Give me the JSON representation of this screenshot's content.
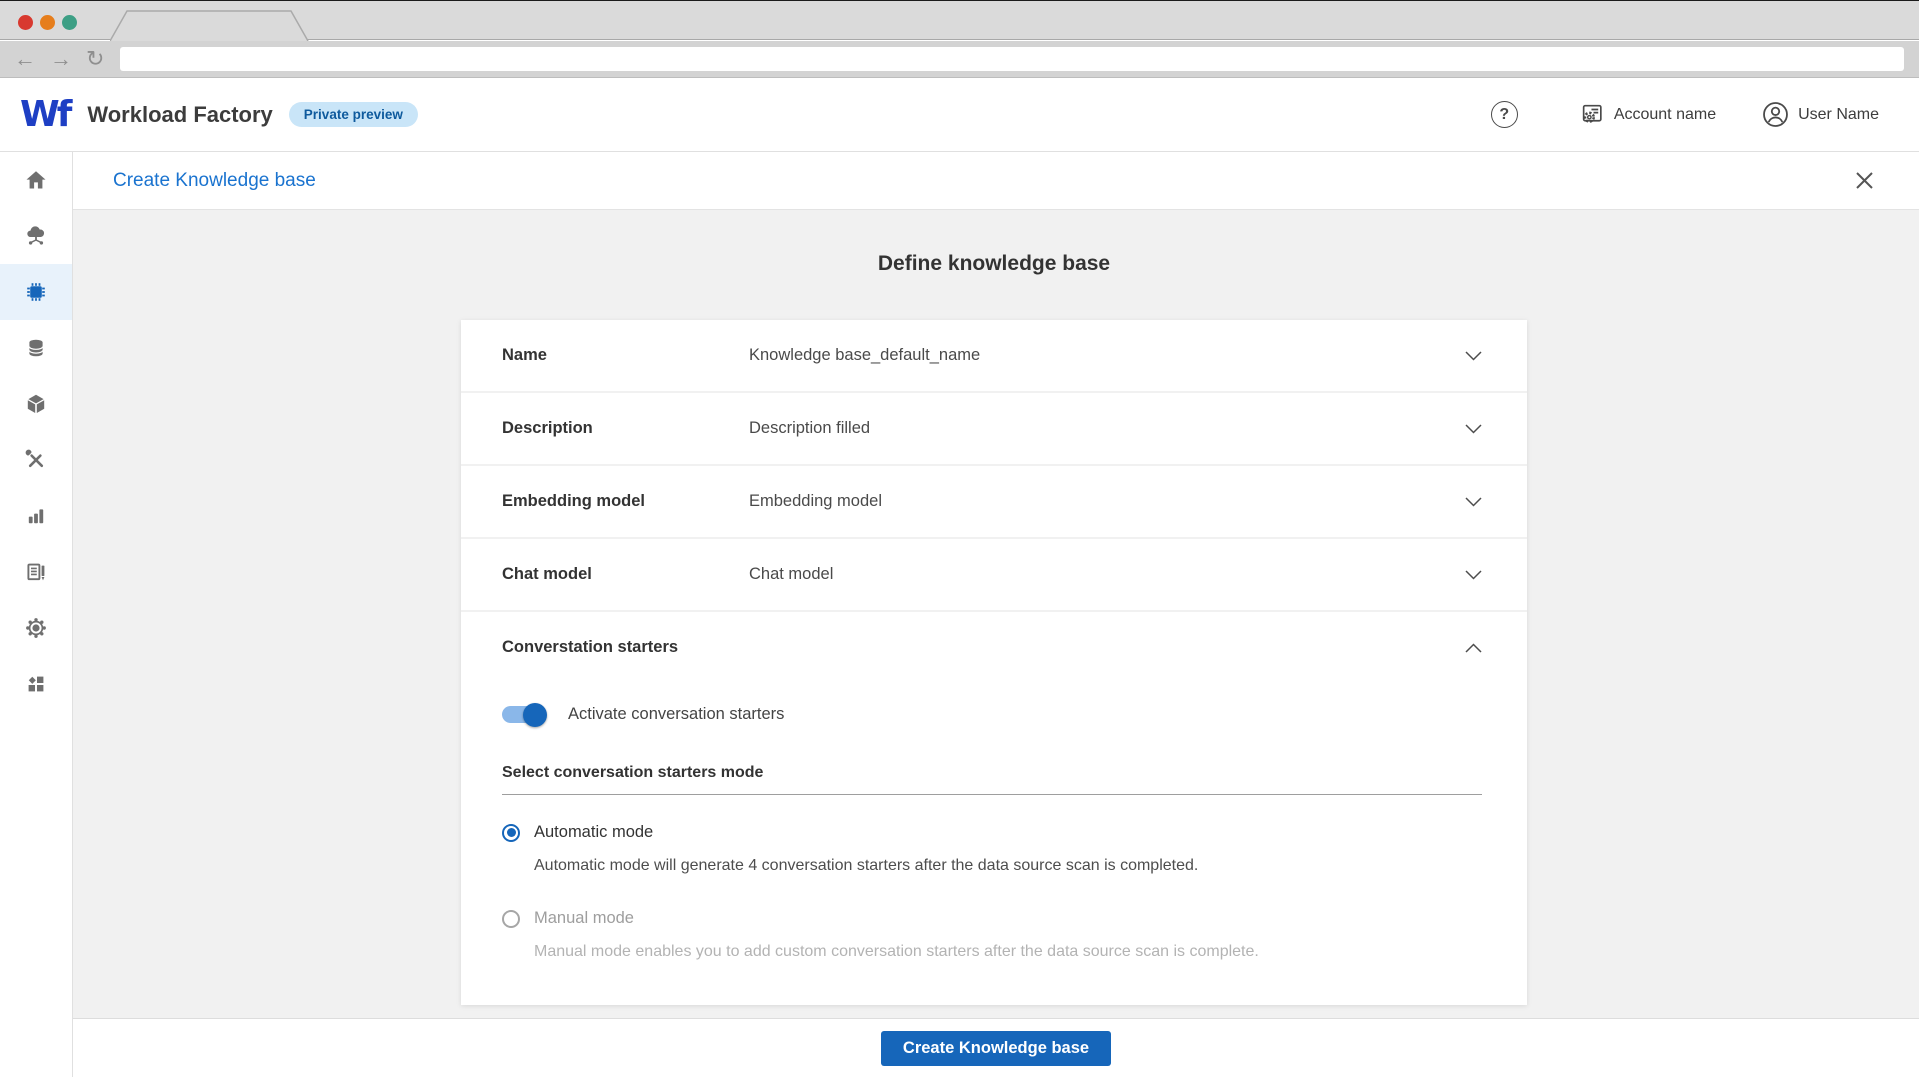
{
  "browser": {
    "url": "",
    "back": "←",
    "forward": "→",
    "reload": "↻"
  },
  "header": {
    "app_name": "Workload Factory",
    "badge": "Private preview",
    "account_label": "Account name",
    "user_label": "User Name"
  },
  "sidebar": {
    "items": [
      {
        "name": "home",
        "active": false
      },
      {
        "name": "cloud-network",
        "active": false
      },
      {
        "name": "ai-chip",
        "active": true
      },
      {
        "name": "storage",
        "active": false
      },
      {
        "name": "cube",
        "active": false
      },
      {
        "name": "tools",
        "active": false
      },
      {
        "name": "bar-chart",
        "active": false
      },
      {
        "name": "report",
        "active": false
      },
      {
        "name": "helm",
        "active": false
      },
      {
        "name": "apps-grid",
        "active": false
      }
    ]
  },
  "page_header": {
    "title": "Create Knowledge base"
  },
  "main": {
    "title": "Define knowledge base",
    "rows": [
      {
        "label": "Name",
        "value": "Knowledge base_default_name"
      },
      {
        "label": "Description",
        "value": "Description filled"
      },
      {
        "label": "Embedding model",
        "value": "Embedding model"
      },
      {
        "label": "Chat model",
        "value": "Chat model"
      }
    ],
    "conversation": {
      "label": "Converstation starters",
      "toggle_label": "Activate conversation starters",
      "toggle_on": true,
      "mode_title": "Select conversation starters mode",
      "options": [
        {
          "label": "Automatic mode",
          "description": "Automatic mode will generate 4 conversation starters after the data source scan is completed.",
          "selected": true,
          "disabled": false
        },
        {
          "label": "Manual mode",
          "description": "Manual mode enables you to add custom conversation starters after the data source scan is complete.",
          "selected": false,
          "disabled": true
        }
      ]
    }
  },
  "footer": {
    "submit_label": "Create Knowledge base"
  },
  "colors": {
    "primary": "#1666ba",
    "link": "#1a73cf",
    "badge_bg": "#c9e5f8",
    "badge_text": "#0e5a9d",
    "sidebar_active_bg": "#e8f2fb",
    "main_bg": "#f1f1f1",
    "traffic_red": "#d8392f",
    "traffic_amber": "#e67e1c",
    "traffic_green": "#3d9f85"
  }
}
